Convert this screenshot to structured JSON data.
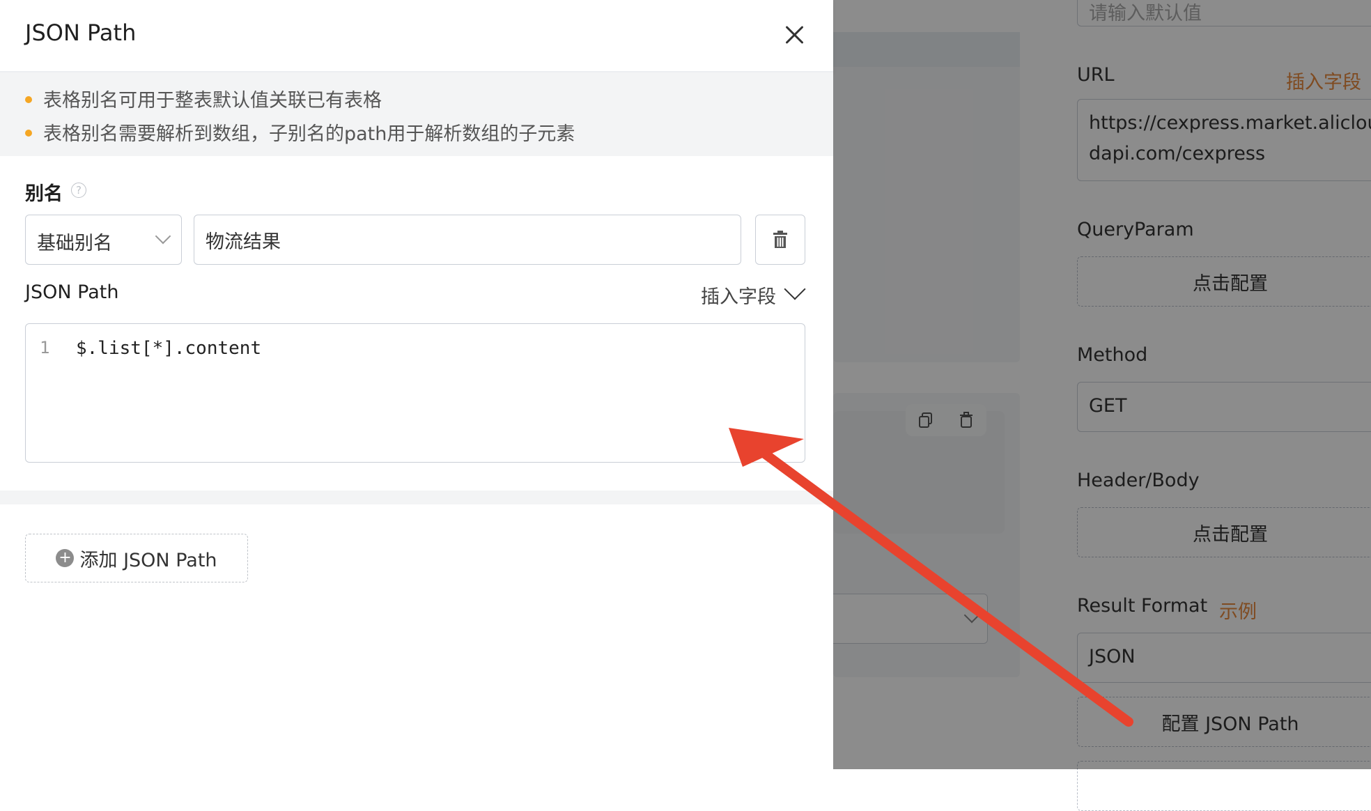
{
  "drawer": {
    "title": "JSON Path",
    "tips": [
      "表格别名可用于整表默认值关联已有表格",
      "表格别名需要解析到数组，子别名的path用于解析数组的子元素"
    ],
    "alias_label": "别名",
    "alias_type_value": "基础别名",
    "alias_name_value": "物流结果",
    "json_path_label": "JSON Path",
    "insert_field_label": "插入字段",
    "code_line_number": "1",
    "code_text": "$.list[*].content",
    "add_button_label": "添加 JSON Path"
  },
  "background": {
    "top_input_partial": "请输入默认值",
    "url_label": "URL",
    "url_insert_field": "插入字段",
    "url_value_line1": "https://cexpress.market.aliclou",
    "url_value_line2": "dapi.com/cexpress",
    "queryparam_label": "QueryParam",
    "queryparam_button": "点击配置",
    "method_label": "Method",
    "method_value": "GET",
    "headerbody_label": "Header/Body",
    "headerbody_button": "点击配置",
    "result_format_label": "Result Format",
    "result_format_example": "示例",
    "result_format_value": "JSON",
    "config_json_path_button": "配置 JSON Path"
  },
  "colors": {
    "accent_orange": "#e8893c",
    "tip_dot": "#f5a623",
    "annotation_arrow": "#e8432e"
  }
}
